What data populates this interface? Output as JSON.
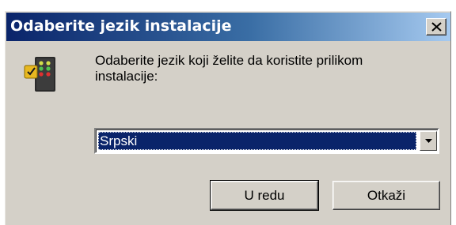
{
  "window": {
    "title": "Odaberite jezik instalacije"
  },
  "dialog": {
    "message": "Odaberite jezik koji želite da koristite prilikom instalacije:",
    "icon": "installer-icon"
  },
  "language_select": {
    "selected": "Srpski"
  },
  "buttons": {
    "ok_label": "U redu",
    "cancel_label": "Otkaži"
  },
  "colors": {
    "title_bar_start": "#0a246a",
    "title_bar_end": "#a6caf0",
    "face": "#d4d0c8",
    "selection": "#0a246a"
  }
}
